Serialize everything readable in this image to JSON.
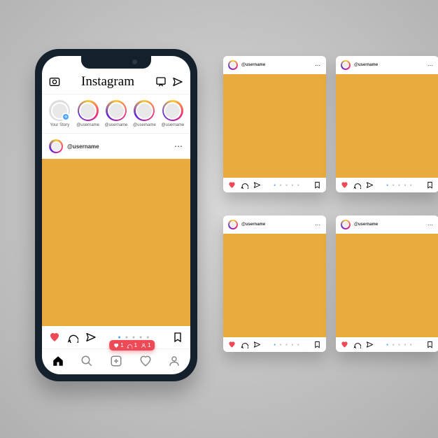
{
  "app": {
    "brand": "Instagram"
  },
  "stories": {
    "own_label": "Your Story",
    "items": [
      {
        "label": "@username"
      },
      {
        "label": "@username"
      },
      {
        "label": "@username"
      },
      {
        "label": "@username"
      }
    ]
  },
  "post": {
    "username": "@username",
    "more": "⋯"
  },
  "notif": {
    "likes": "1",
    "comments": "1",
    "followers": "1"
  },
  "card": {
    "username": "@username",
    "more": "⋯"
  }
}
